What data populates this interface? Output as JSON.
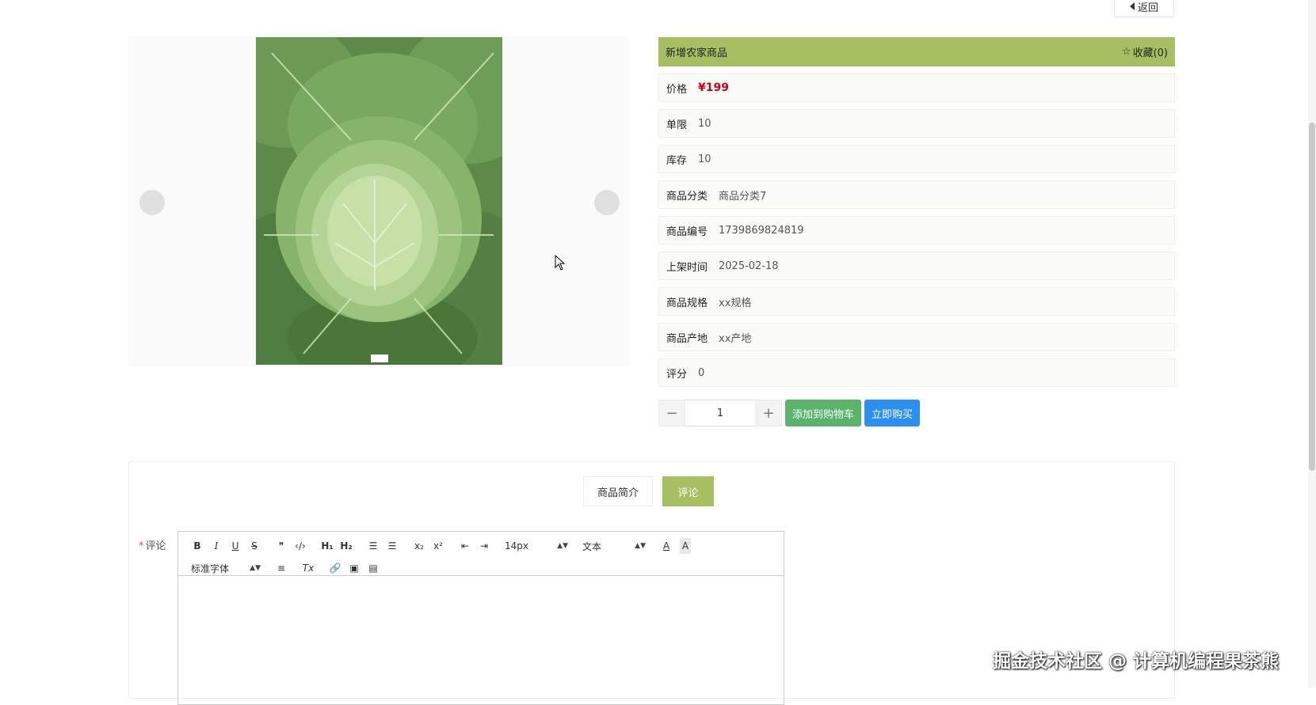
{
  "topbar": {
    "back_label": "返回"
  },
  "product": {
    "title": "新增农家商品",
    "favorite_label": "收藏(0)",
    "fields": [
      {
        "label": "价格",
        "value": "¥199",
        "type": "price"
      },
      {
        "label": "单限",
        "value": "10"
      },
      {
        "label": "库存",
        "value": "10"
      },
      {
        "label": "商品分类",
        "value": "商品分类7"
      },
      {
        "label": "商品编号",
        "value": "1739869824819"
      },
      {
        "label": "上架时间",
        "value": "2025-02-18"
      },
      {
        "label": "商品规格",
        "value": "xx规格"
      },
      {
        "label": "商品产地",
        "value": "xx产地"
      },
      {
        "label": "评分",
        "value": "0"
      }
    ]
  },
  "purchase": {
    "minus": "−",
    "plus": "+",
    "quantity": "1",
    "add_to_cart_label": "添加到购物车",
    "buy_now_label": "立即购买"
  },
  "detail_tabs": [
    {
      "label": "商品简介",
      "active": false
    },
    {
      "label": "评论",
      "active": true
    }
  ],
  "comment": {
    "required_mark": "*",
    "label": "评论",
    "toolbar": {
      "bold": "B",
      "italic": "I",
      "underline": "U",
      "strike": "S",
      "quote": "❞",
      "code": "‹/›",
      "h1": "H₁",
      "h2": "H₂",
      "ordered_list": "☰",
      "bullet_list": "☰",
      "subscript": "x₂",
      "superscript": "x²",
      "outdent": "⇤",
      "indent": "⇥",
      "font_size": "14px",
      "header": "文本",
      "font_color": "A",
      "background_color": "A",
      "font_family": "标准字体",
      "align": "≡",
      "clean": "Tx",
      "link": "🔗",
      "image": "▣",
      "video": "▤"
    }
  },
  "watermark": "掘金技术社区 @ 计算机编程果茶熊",
  "colors": {
    "accent": "#a6bf62",
    "price": "#d0021b",
    "cart_button": "#5ab36a",
    "buy_button": "#2a8ff0"
  }
}
